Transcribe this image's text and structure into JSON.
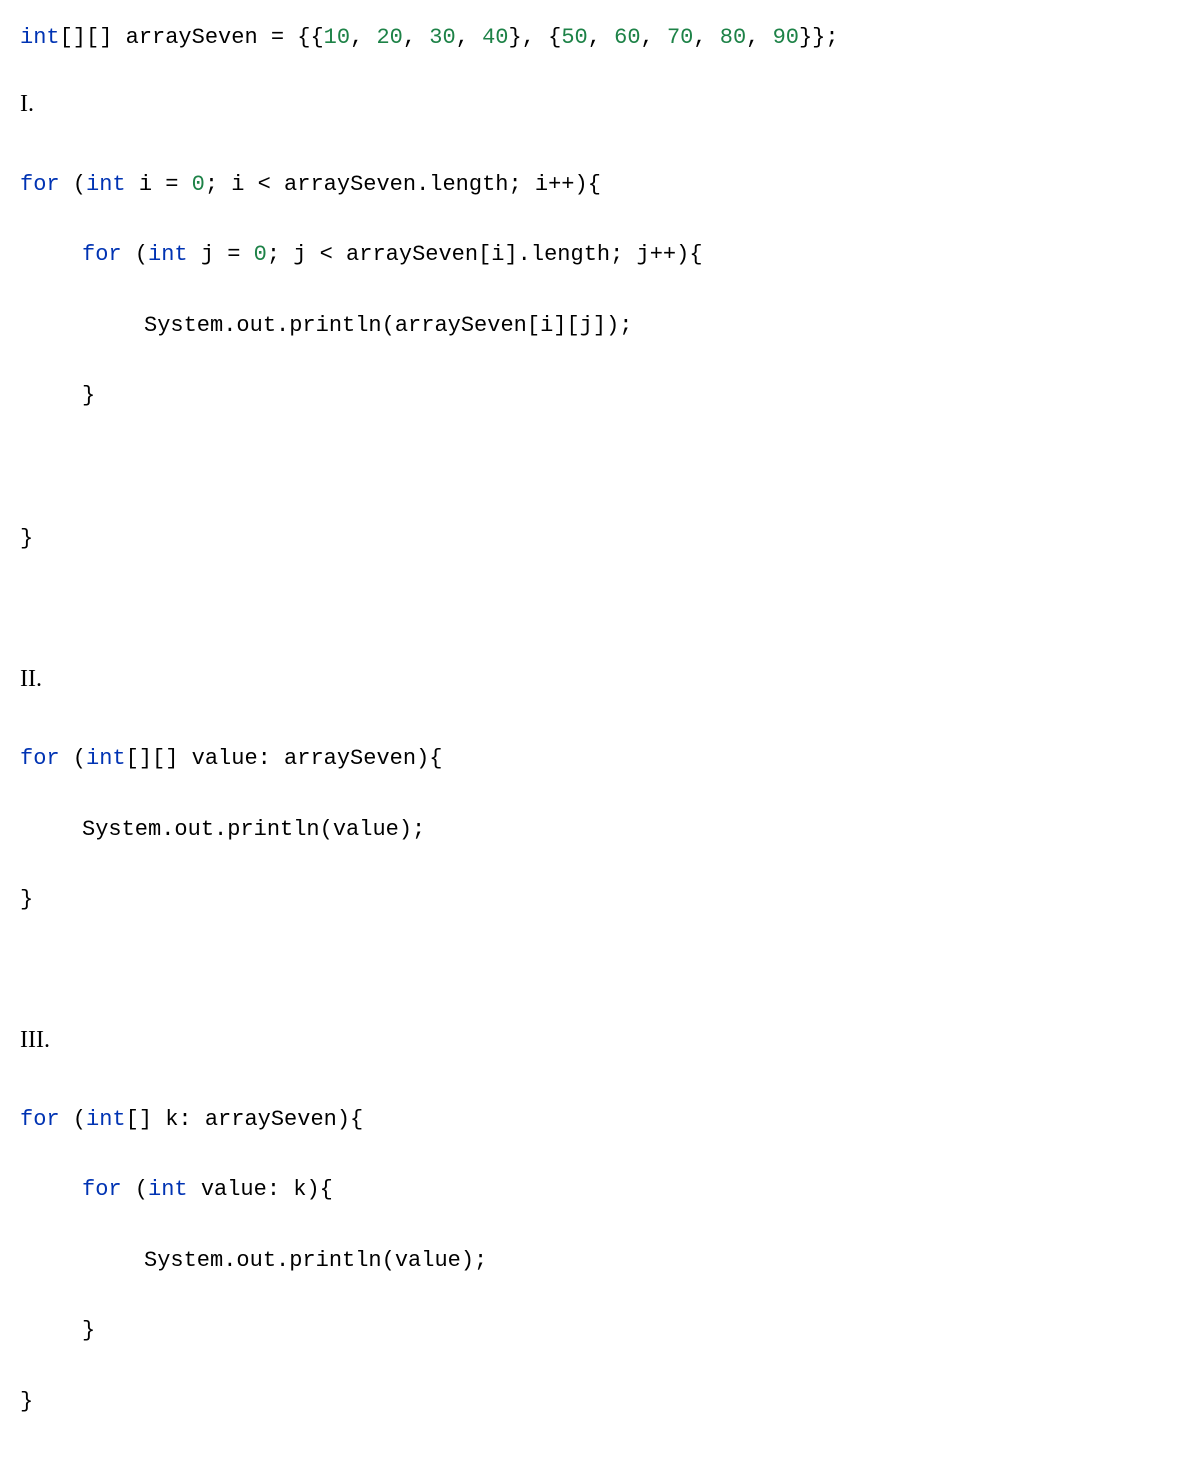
{
  "declaration": {
    "kw_int": "int",
    "brackets": "[][] ",
    "var": "arraySeven = {{",
    "n1": "10",
    "c1": ", ",
    "n2": "20",
    "c2": ", ",
    "n3": "30",
    "c3": ", ",
    "n4": "40",
    "mid": "}, {",
    "n5": "50",
    "c5": ", ",
    "n6": "60",
    "c6": ", ",
    "n7": "70",
    "c7": ", ",
    "n8": "80",
    "c8": ", ",
    "n9": "90",
    "end": "}};"
  },
  "labels": {
    "i": "I.",
    "ii": "II.",
    "iii": "III."
  },
  "blockI": {
    "l1a": "for",
    "l1b": " (",
    "l1c": "int",
    "l1d": " i = ",
    "l1e": "0",
    "l1f": "; i < arraySeven.length; i++){",
    "l2a": "for",
    "l2b": " (",
    "l2c": "int",
    "l2d": " j = ",
    "l2e": "0",
    "l2f": "; j < arraySeven[i].length; j++){",
    "l3": "System.out.println(arraySeven[i][j]);",
    "l4": "}",
    "l5": "}"
  },
  "blockII": {
    "l1a": "for",
    "l1b": " (",
    "l1c": "int",
    "l1d": "[][] value: arraySeven){",
    "l2": "System.out.println(value);",
    "l3": "}"
  },
  "blockIII": {
    "l1a": "for",
    "l1b": " (",
    "l1c": "int",
    "l1d": "[] k: arraySeven){",
    "l2a": "for",
    "l2b": " (",
    "l2c": "int",
    "l2d": " value: k){",
    "l3": "System.out.println(value);",
    "l4": "}",
    "l5": "}"
  }
}
